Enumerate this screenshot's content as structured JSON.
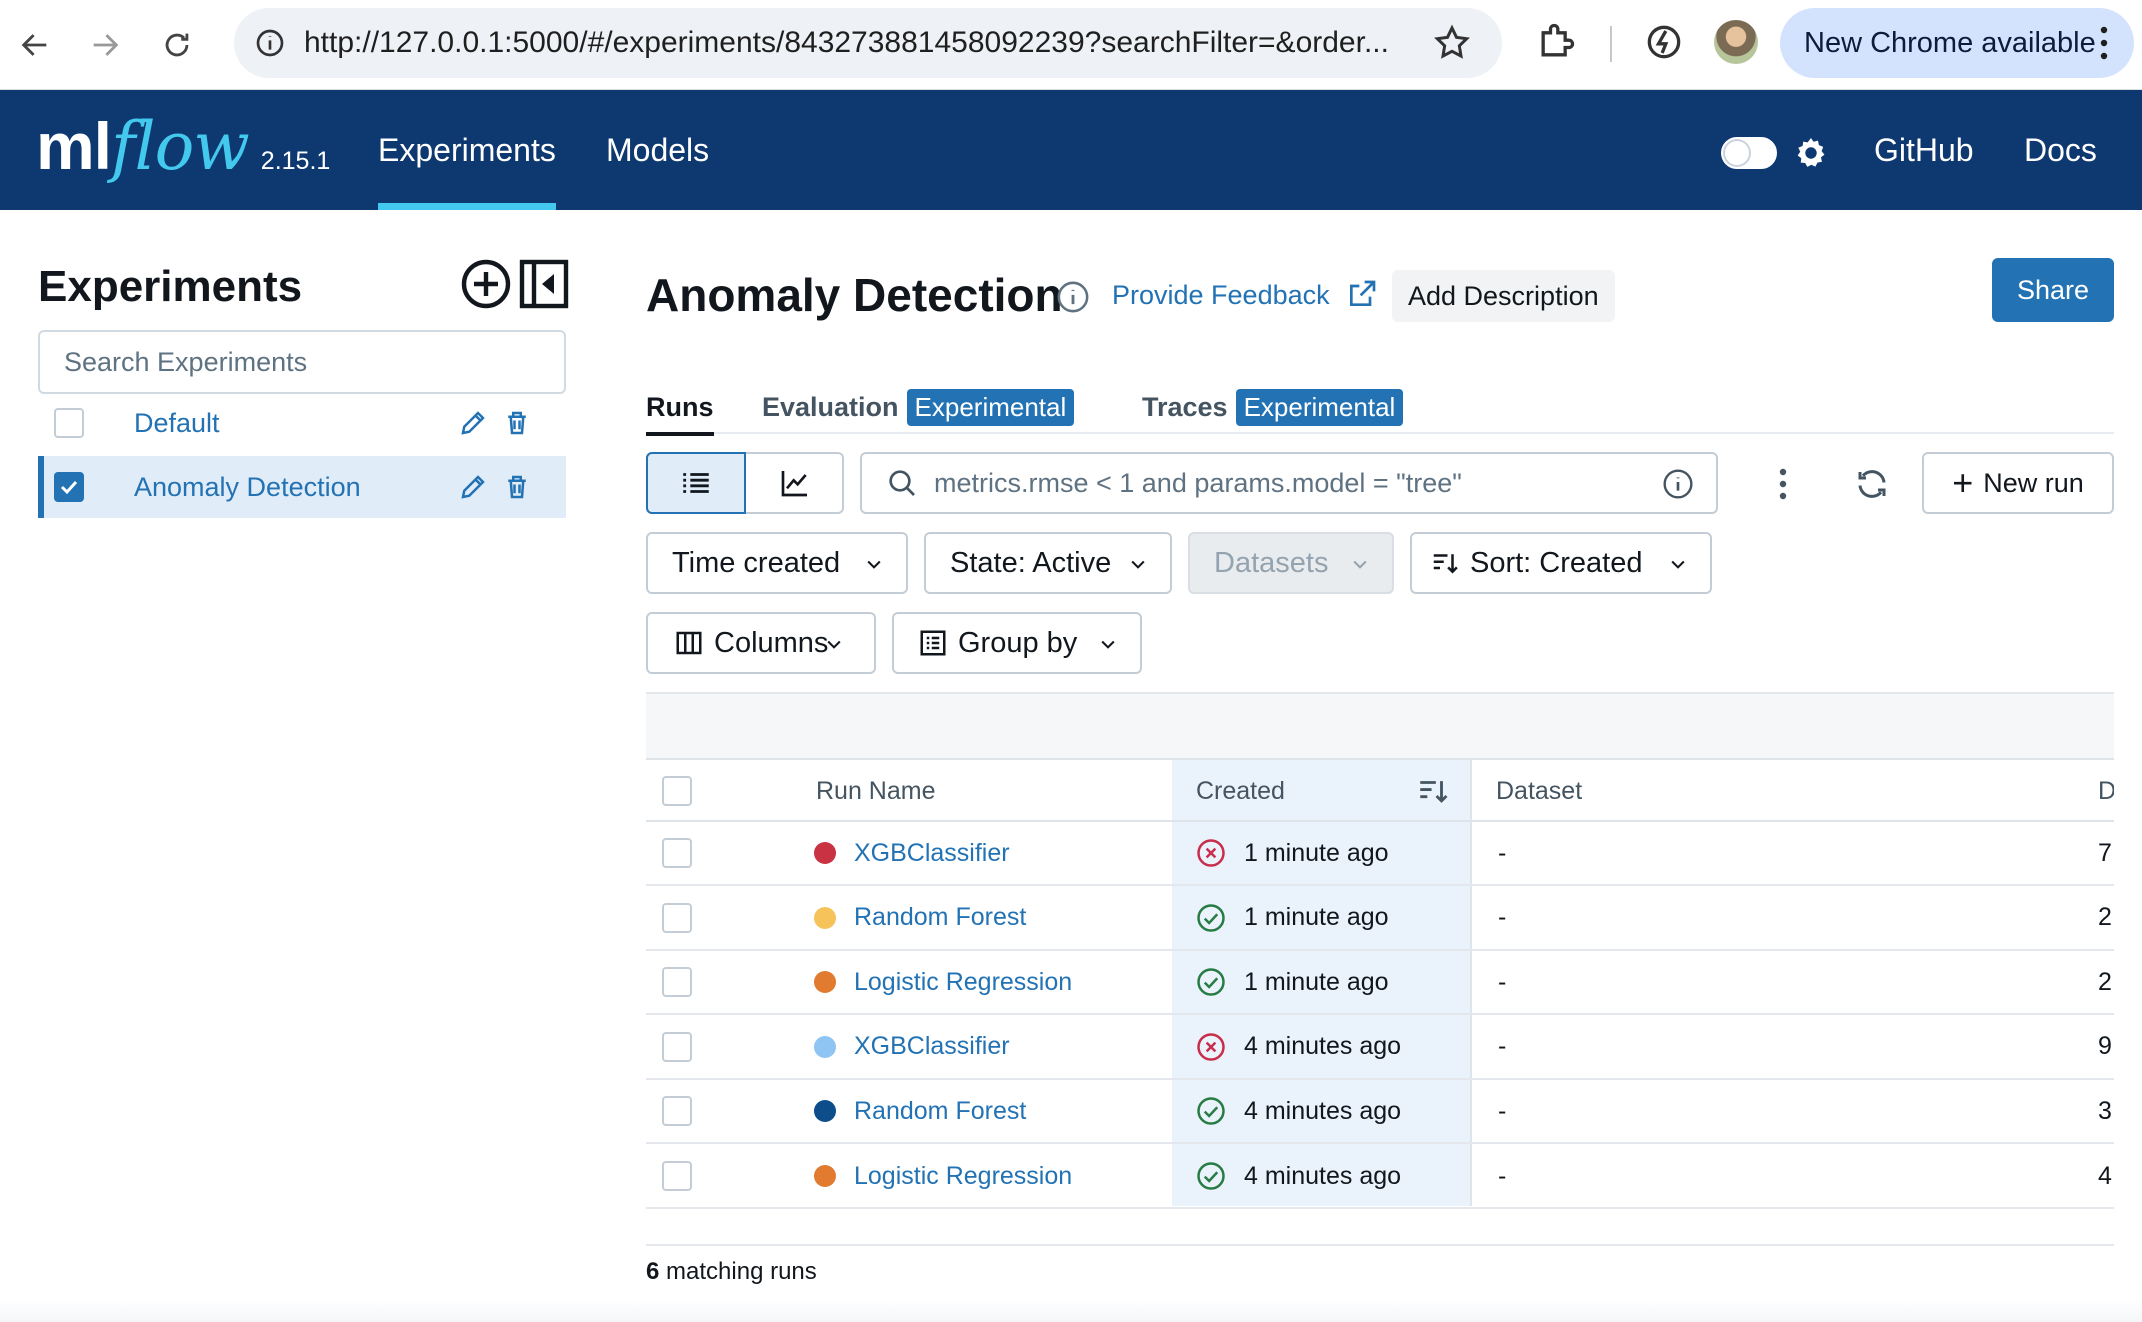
{
  "browser": {
    "url": "http://127.0.0.1:5000/#/experiments/843273881458092239?searchFilter=&order...",
    "update_label": "New Chrome available"
  },
  "app": {
    "logo_ml": "ml",
    "logo_flow": "flow",
    "version": "2.15.1",
    "nav": {
      "experiments": "Experiments",
      "models": "Models"
    },
    "right_links": {
      "github": "GitHub",
      "docs": "Docs"
    },
    "theme_toggle_on": false
  },
  "sidebar": {
    "title": "Experiments",
    "search_placeholder": "Search Experiments",
    "experiments": [
      {
        "name": "Default",
        "checked": false
      },
      {
        "name": "Anomaly Detection",
        "checked": true
      }
    ]
  },
  "main": {
    "title": "Anomaly Detection",
    "feedback": "Provide Feedback",
    "add_description": "Add Description",
    "share": "Share",
    "tabs": [
      {
        "label": "Runs",
        "badge": ""
      },
      {
        "label": "Evaluation",
        "badge": "Experimental"
      },
      {
        "label": "Traces",
        "badge": "Experimental"
      }
    ],
    "search_placeholder": "metrics.rmse < 1 and params.model = \"tree\"",
    "new_run": "New run",
    "filters": {
      "time": "Time created",
      "state": "State: Active",
      "datasets": "Datasets",
      "sort": "Sort: Created",
      "columns": "Columns",
      "group_by": "Group by"
    },
    "columns": {
      "run_name": "Run Name",
      "created": "Created",
      "dataset": "Dataset",
      "duration_partial": "D"
    },
    "runs": [
      {
        "name": "XGBClassifier",
        "color": "#c83243",
        "status": "failed",
        "created": "1 minute ago",
        "dataset": "-",
        "duration": "7."
      },
      {
        "name": "Random Forest",
        "color": "#f6c35b",
        "status": "finished",
        "created": "1 minute ago",
        "dataset": "-",
        "duration": "2."
      },
      {
        "name": "Logistic Regression",
        "color": "#e07b2f",
        "status": "finished",
        "created": "1 minute ago",
        "dataset": "-",
        "duration": "2."
      },
      {
        "name": "XGBClassifier",
        "color": "#8ec5f2",
        "status": "failed",
        "created": "4 minutes ago",
        "dataset": "-",
        "duration": "9."
      },
      {
        "name": "Random Forest",
        "color": "#0d4d8a",
        "status": "finished",
        "created": "4 minutes ago",
        "dataset": "-",
        "duration": "3."
      },
      {
        "name": "Logistic Regression",
        "color": "#e07b2f",
        "status": "finished",
        "created": "4 minutes ago",
        "dataset": "-",
        "duration": "4."
      }
    ],
    "matching_count": "6",
    "matching_label": "matching runs"
  }
}
